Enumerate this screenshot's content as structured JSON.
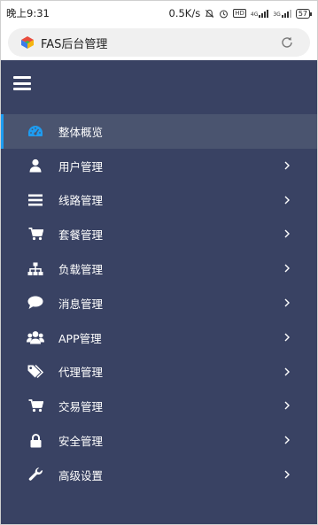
{
  "status_bar": {
    "time": "晚上9:31",
    "speed": "0.5K/s",
    "hd": "HD",
    "net1": "4G",
    "net2": "3G",
    "battery": "57"
  },
  "browser": {
    "address_title": "FAS后台管理"
  },
  "sidebar": {
    "items": [
      {
        "label": "整体概览",
        "icon": "dashboard-icon",
        "active": true,
        "chevron": false
      },
      {
        "label": "用户管理",
        "icon": "user-icon",
        "active": false,
        "chevron": true
      },
      {
        "label": "线路管理",
        "icon": "list-icon",
        "active": false,
        "chevron": true
      },
      {
        "label": "套餐管理",
        "icon": "cart-icon",
        "active": false,
        "chevron": true
      },
      {
        "label": "负载管理",
        "icon": "sitemap-icon",
        "active": false,
        "chevron": true
      },
      {
        "label": "消息管理",
        "icon": "chat-bubble-icon",
        "active": false,
        "chevron": true
      },
      {
        "label": "APP管理",
        "icon": "users-icon",
        "active": false,
        "chevron": true
      },
      {
        "label": "代理管理",
        "icon": "tags-icon",
        "active": false,
        "chevron": true
      },
      {
        "label": "交易管理",
        "icon": "cart-icon",
        "active": false,
        "chevron": true
      },
      {
        "label": "安全管理",
        "icon": "lock-icon",
        "active": false,
        "chevron": true
      },
      {
        "label": "高级设置",
        "icon": "wrench-icon",
        "active": false,
        "chevron": true
      }
    ]
  },
  "colors": {
    "sidebar_bg": "#394263",
    "active_bg": "#4a546f",
    "accent": "#1e9cf0"
  }
}
